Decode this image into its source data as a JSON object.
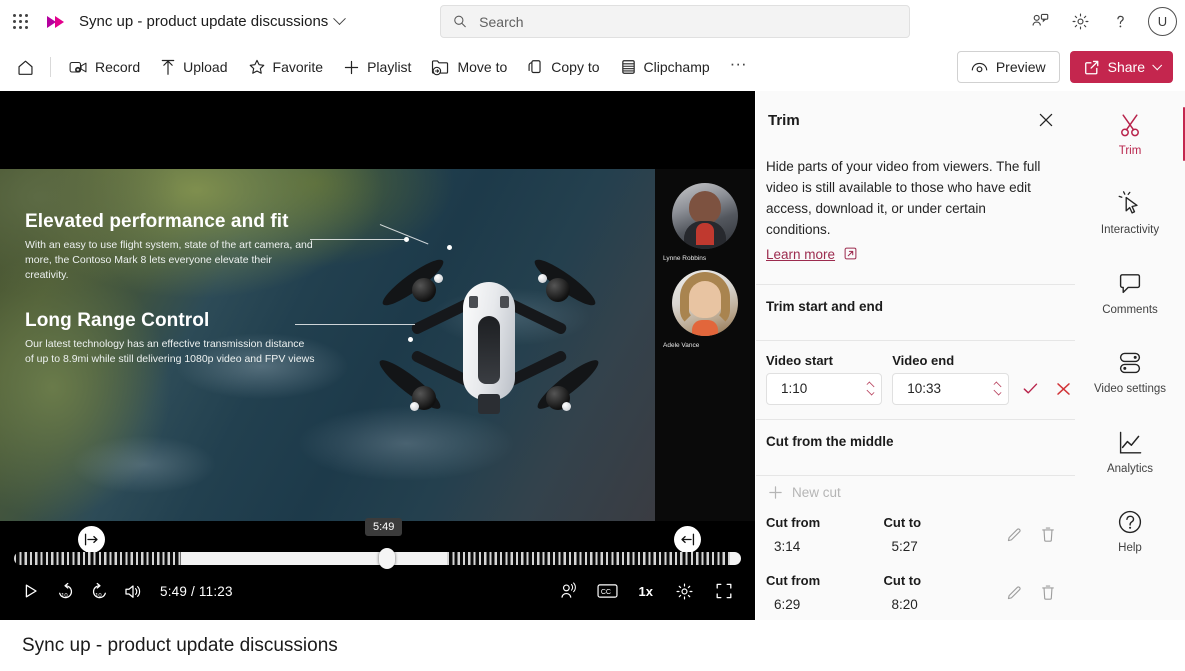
{
  "topbar": {
    "app_title": "Sync up - product update discussions",
    "search_placeholder": "Search",
    "search_value": "",
    "avatar_initial": "U",
    "icons": [
      "waffle-icon",
      "stream-logo-icon",
      "search-icon",
      "meet-now-icon",
      "settings-gear-icon",
      "help-question-icon"
    ]
  },
  "commandbar": {
    "home_label": "Home",
    "items": [
      {
        "label": "Record",
        "icon": "record-icon"
      },
      {
        "label": "Upload",
        "icon": "upload-arrow-icon"
      },
      {
        "label": "Favorite",
        "icon": "star-icon"
      },
      {
        "label": "Playlist",
        "icon": "plus-icon"
      },
      {
        "label": "Move to",
        "icon": "move-to-folder-icon"
      },
      {
        "label": "Copy to",
        "icon": "copy-to-icon"
      },
      {
        "label": "Clipchamp",
        "icon": "clipchamp-icon"
      }
    ],
    "overflow_label": "···",
    "preview_label": "Preview",
    "share_label": "Share",
    "accent_color": "#c4264e"
  },
  "player": {
    "current_time": "5:49",
    "total_time": "11:23",
    "time_display": "5:49 / 11:23",
    "scrub_tooltip": "5:49",
    "speed_label": "1x",
    "cc_label": "CC",
    "controls": [
      "play-icon",
      "rewind-10-icon",
      "forward-10-icon",
      "volume-icon",
      "noise-suppression-icon",
      "closed-captions-icon",
      "playback-speed-icon",
      "settings-gear-icon",
      "fullscreen-icon"
    ],
    "trim_start_handle": "trim-start-handle",
    "trim_end_handle": "trim-end-handle",
    "slide": {
      "heading1": "Elevated performance and fit",
      "body1": "With an easy to use flight system, state of the art camera, and more, the Contoso Mark 8 lets everyone elevate their creativity.",
      "heading2": "Long Range Control",
      "body2": "Our latest technology has an effective transmission distance of up to 8.9mi while still delivering 1080p video and FPV views"
    },
    "participants": [
      {
        "name": "Lynne Robbins"
      },
      {
        "name": "Adele Vance"
      }
    ],
    "timeline_segments": [
      {
        "type": "hatch",
        "left_pct": 0.0,
        "width_pct": 23.0
      },
      {
        "type": "play",
        "left_pct": 23.0,
        "width_pct": 36.5
      },
      {
        "type": "hatch",
        "left_pct": 59.5,
        "width_pct": 39.0
      },
      {
        "type": "play",
        "left_pct": 98.5,
        "width_pct": 1.5
      }
    ]
  },
  "trim_panel": {
    "title": "Trim",
    "close_icon": "close-icon",
    "description": "Hide parts of your video from viewers. The full video is still available to those who have edit access, download it, or under certain conditions.",
    "learn_more": "Learn more",
    "learn_more_icon": "external-link-icon",
    "section_start_end": "Trim start and end",
    "video_start_label": "Video start",
    "video_start_value": "1:10",
    "video_end_label": "Video end",
    "video_end_value": "10:33",
    "confirm_icon": "checkmark-icon",
    "cancel_icon": "dismiss-icon",
    "section_middle": "Cut from the middle",
    "new_cut_label": "New cut",
    "cut_from_label": "Cut from",
    "cut_to_label": "Cut to",
    "cuts": [
      {
        "from": "3:14",
        "to": "5:27"
      },
      {
        "from": "6:29",
        "to": "8:20"
      }
    ]
  },
  "rail": {
    "items": [
      {
        "label": "Trim",
        "icon": "scissors-icon",
        "active": true
      },
      {
        "label": "Interactivity",
        "icon": "cursor-click-icon",
        "active": false
      },
      {
        "label": "Comments",
        "icon": "comment-bubble-icon",
        "active": false
      },
      {
        "label": "Video settings",
        "icon": "toggles-icon",
        "active": false
      },
      {
        "label": "Analytics",
        "icon": "line-chart-icon",
        "active": false
      },
      {
        "label": "Help",
        "icon": "help-circle-icon",
        "active": false
      }
    ]
  },
  "footer": {
    "video_title": "Sync up - product update discussions"
  }
}
